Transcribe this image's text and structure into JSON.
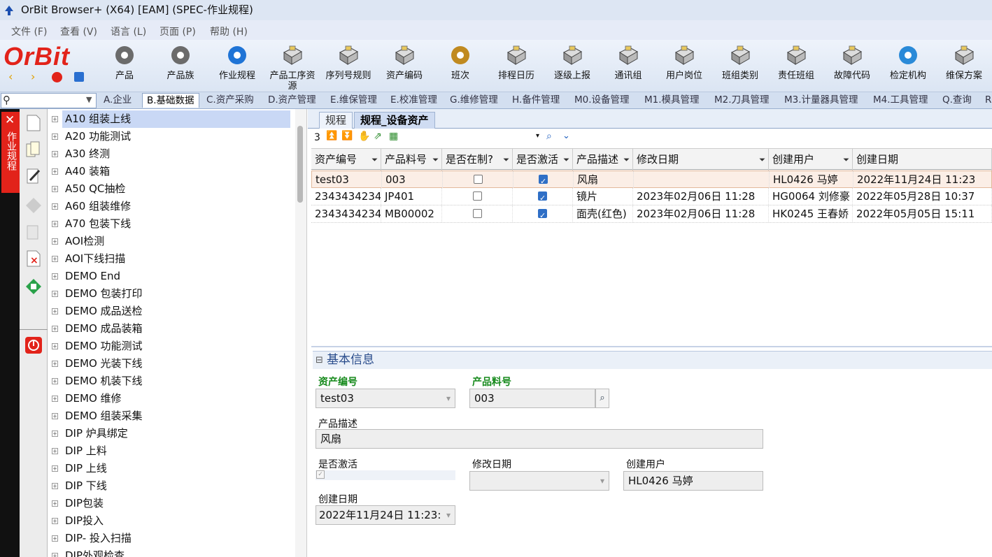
{
  "window": {
    "title": "OrBit Browser+ (X64) [EAM] (SPEC-作业规程)"
  },
  "menu": [
    "文件 (F)",
    "查看 (V)",
    "语言 (L)",
    "页面 (P)",
    "帮助 (H)"
  ],
  "logo": "OrBit",
  "toolbar": {
    "buttons": [
      {
        "label": "产品",
        "icon": "product-icon"
      },
      {
        "label": "产品族",
        "icon": "product-family-icon"
      },
      {
        "label": "作业规程",
        "icon": "gear-icon"
      },
      {
        "label": "产品工序资源",
        "icon": "package-icon"
      },
      {
        "label": "序列号规则",
        "icon": "package-icon"
      },
      {
        "label": "资产编码",
        "icon": "package-icon"
      },
      {
        "label": "班次",
        "icon": "clock-icon"
      },
      {
        "label": "排程日历",
        "icon": "package-icon"
      },
      {
        "label": "逐级上报",
        "icon": "package-icon"
      },
      {
        "label": "通讯组",
        "icon": "package-icon"
      },
      {
        "label": "用户岗位",
        "icon": "package-icon"
      },
      {
        "label": "班组类别",
        "icon": "package-icon"
      },
      {
        "label": "责任班组",
        "icon": "package-icon"
      },
      {
        "label": "故障代码",
        "icon": "package-icon"
      },
      {
        "label": "检定机构",
        "icon": "user-icon"
      },
      {
        "label": "维保方案",
        "icon": "package-icon"
      }
    ]
  },
  "module_tabs": [
    "A.企业",
    "B.基础数据",
    "C.资产采购",
    "D.资产管理",
    "E.维保管理",
    "E.校准管理",
    "G.维修管理",
    "H.备件管理",
    "M0.设备管理",
    "M1.模具管理",
    "M2.刀具管理",
    "M3.计量器具管理",
    "M4.工具管理",
    "Q.查询",
    "R"
  ],
  "active_module_tab": "B.基础数据",
  "side_label": "作业规程",
  "tree": {
    "items": [
      "A10 组装上线",
      "A20 功能测试",
      "A30 终测",
      "A40 装箱",
      "A50 QC抽检",
      "A60 组装维修",
      "A70 包装下线",
      "AOI检测",
      "AOI下线扫描",
      "DEMO End",
      "DEMO 包装打印",
      "DEMO 成品送检",
      "DEMO 成品装箱",
      "DEMO 功能测试",
      "DEMO 光装下线",
      "DEMO 机装下线",
      "DEMO 维修",
      "DEMO 组装采集",
      "DIP 炉具绑定",
      "DIP 上料",
      "DIP 上线",
      "DIP 下线",
      "DIP包装",
      "DIP投入",
      "DIP- 投入扫描",
      "DIP外观检查"
    ],
    "selected": 0
  },
  "subtabs": [
    "规程",
    "规程_设备资产"
  ],
  "grid": {
    "count": "3",
    "columns": [
      "资产编号",
      "产品料号",
      "是否在制?",
      "是否激活",
      "产品描述",
      "修改日期",
      "创建用户",
      "创建日期"
    ],
    "rows": [
      {
        "asset": "test03",
        "part": "003",
        "wip": false,
        "active": true,
        "desc": "风扇",
        "modified": "",
        "user": "HL0426 马婷",
        "created": "2022年11月24日 11:23"
      },
      {
        "asset": "2343434234",
        "part": "JP401",
        "wip": false,
        "active": true,
        "desc": "镜片",
        "modified": "2023年02月06日 11:28",
        "user": "HG0064 刘修豪",
        "created": "2022年05月28日 10:37"
      },
      {
        "asset": "2343434234",
        "part": "MB00002",
        "wip": false,
        "active": true,
        "desc": "面壳(红色)",
        "modified": "2023年02月06日 11:28",
        "user": "HK0245 王春娇",
        "created": "2022年05月05日 15:11"
      }
    ]
  },
  "detail": {
    "section_title": "基本信息",
    "asset_label": "资产编号",
    "asset_value": "test03",
    "part_label": "产品料号",
    "part_value": "003",
    "desc_label": "产品描述",
    "desc_value": "风扇",
    "active_label": "是否激活",
    "modified_label": "修改日期",
    "modified_value": "",
    "user_label": "创建用户",
    "user_value": "HL0426 马婷",
    "created_label": "创建日期",
    "created_value": "2022年11月24日 11:23:"
  }
}
